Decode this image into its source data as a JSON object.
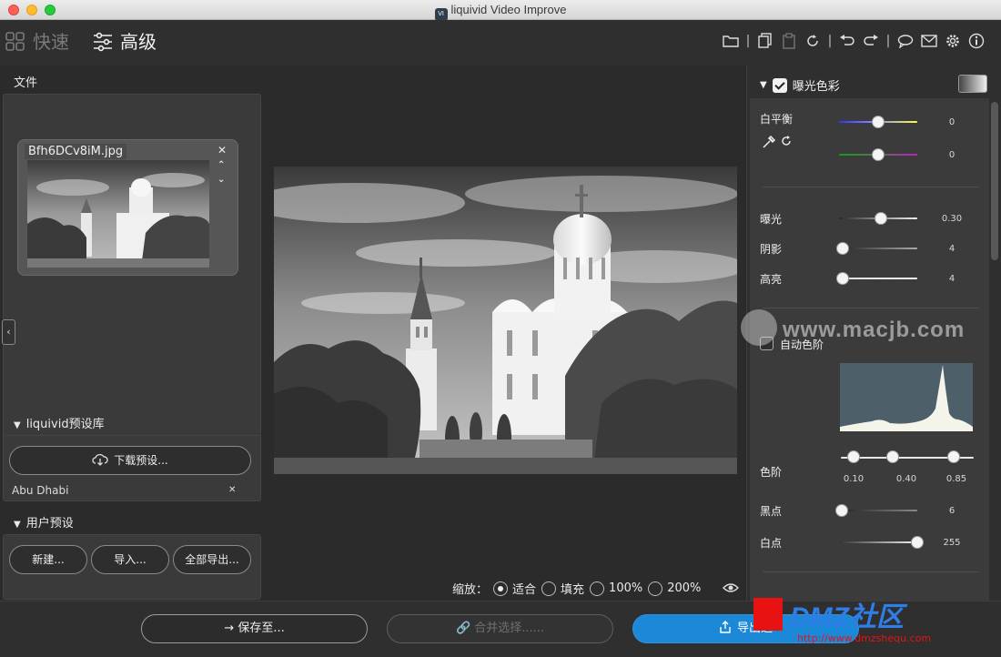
{
  "window": {
    "title": "liquivid Video Improve",
    "app_icon_text": "VI"
  },
  "modes": {
    "quick": "快速",
    "advanced": "高级"
  },
  "toolbar_icons": [
    "folder-icon",
    "copy-icon",
    "paste-icon",
    "reset-icon",
    "undo-icon",
    "redo-icon",
    "chat-icon",
    "mail-icon",
    "settings-icon",
    "info-icon"
  ],
  "files": {
    "section_title": "文件",
    "items": [
      {
        "name": "Bfh6DCv8iM.jpg"
      }
    ]
  },
  "preset_library": {
    "title": "liquivid预设库",
    "download_button": "下载预设...",
    "items": [
      {
        "name": "Abu Dhabi"
      }
    ]
  },
  "user_presets": {
    "title": "用户预设",
    "buttons": {
      "new": "新建...",
      "import": "导入...",
      "export_all": "全部导出..."
    }
  },
  "zoom": {
    "label": "缩放：",
    "options": [
      "适合",
      "填充",
      "100%",
      "200%"
    ],
    "selected": "适合"
  },
  "bottom": {
    "save": "保存至...",
    "merge": "合并选择......",
    "export": "导出选"
  },
  "adjust": {
    "section_title": "曝光色彩",
    "white_balance": {
      "label": "白平衡",
      "temperature": {
        "value": "0",
        "level": 0.49
      },
      "tint": {
        "value": "0",
        "level": 0.49
      }
    },
    "exposure": {
      "label": "曝光",
      "value": "0.30",
      "level": 0.53
    },
    "shadows": {
      "label": "阴影",
      "value": "4",
      "level": 0.02
    },
    "highlights": {
      "label": "高亮",
      "value": "4",
      "level": 0.02
    },
    "auto_levels": {
      "label": "自动色阶",
      "checked": false
    },
    "levels": {
      "label": "色阶",
      "values": [
        "0.10",
        "0.40",
        "0.85"
      ]
    },
    "black_point": {
      "label": "黑点",
      "value": "6",
      "level": 0.02
    },
    "white_point": {
      "label": "白点",
      "value": "255",
      "level": 1.0
    }
  },
  "watermarks": {
    "site1": "www.macjb.com",
    "site2": "DMZ社区",
    "site2_url": "http://www.dmzshequ.com"
  },
  "colors": {
    "accent": "#1b88d8",
    "background": "#2b2b2b",
    "panel": "#3a3a3a"
  }
}
